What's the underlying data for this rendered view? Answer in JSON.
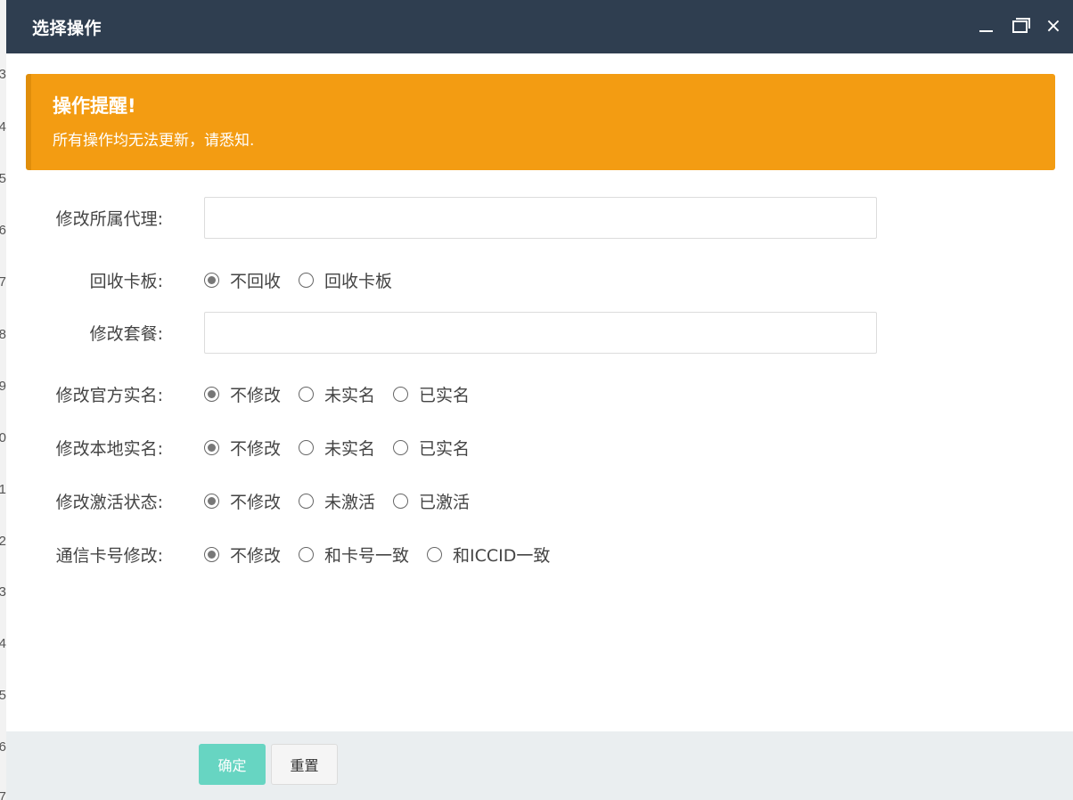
{
  "background": {
    "row_numbers": [
      "3",
      "4",
      "5",
      "6",
      "7",
      "8",
      "9",
      "0",
      "1",
      "2",
      "3",
      "4",
      "5",
      "6",
      "7"
    ]
  },
  "dialog": {
    "title": "选择操作",
    "controls": {
      "minimize": "minimize-icon",
      "maximize": "maximize-icon",
      "close": "×"
    }
  },
  "alert": {
    "title": "操作提醒!",
    "text": "所有操作均无法更新，请悉知."
  },
  "form": {
    "agent": {
      "label": "修改所属代理:",
      "value": ""
    },
    "recycle_board": {
      "label": "回收卡板:",
      "options": [
        "不回收",
        "回收卡板"
      ],
      "selected": 0
    },
    "package": {
      "label": "修改套餐:",
      "value": ""
    },
    "official_realname": {
      "label": "修改官方实名:",
      "options": [
        "不修改",
        "未实名",
        "已实名"
      ],
      "selected": 0
    },
    "local_realname": {
      "label": "修改本地实名:",
      "options": [
        "不修改",
        "未实名",
        "已实名"
      ],
      "selected": 0
    },
    "activation": {
      "label": "修改激活状态:",
      "options": [
        "不修改",
        "未激活",
        "已激活"
      ],
      "selected": 0
    },
    "comm_number": {
      "label": "通信卡号修改:",
      "options": [
        "不修改",
        "和卡号一致",
        "和ICCID一致"
      ],
      "selected": 0
    }
  },
  "footer": {
    "confirm_label": "确定",
    "reset_label": "重置"
  },
  "colors": {
    "titlebar": "#2f3e50",
    "alert": "#f39c12",
    "confirm": "#67d5c2"
  }
}
